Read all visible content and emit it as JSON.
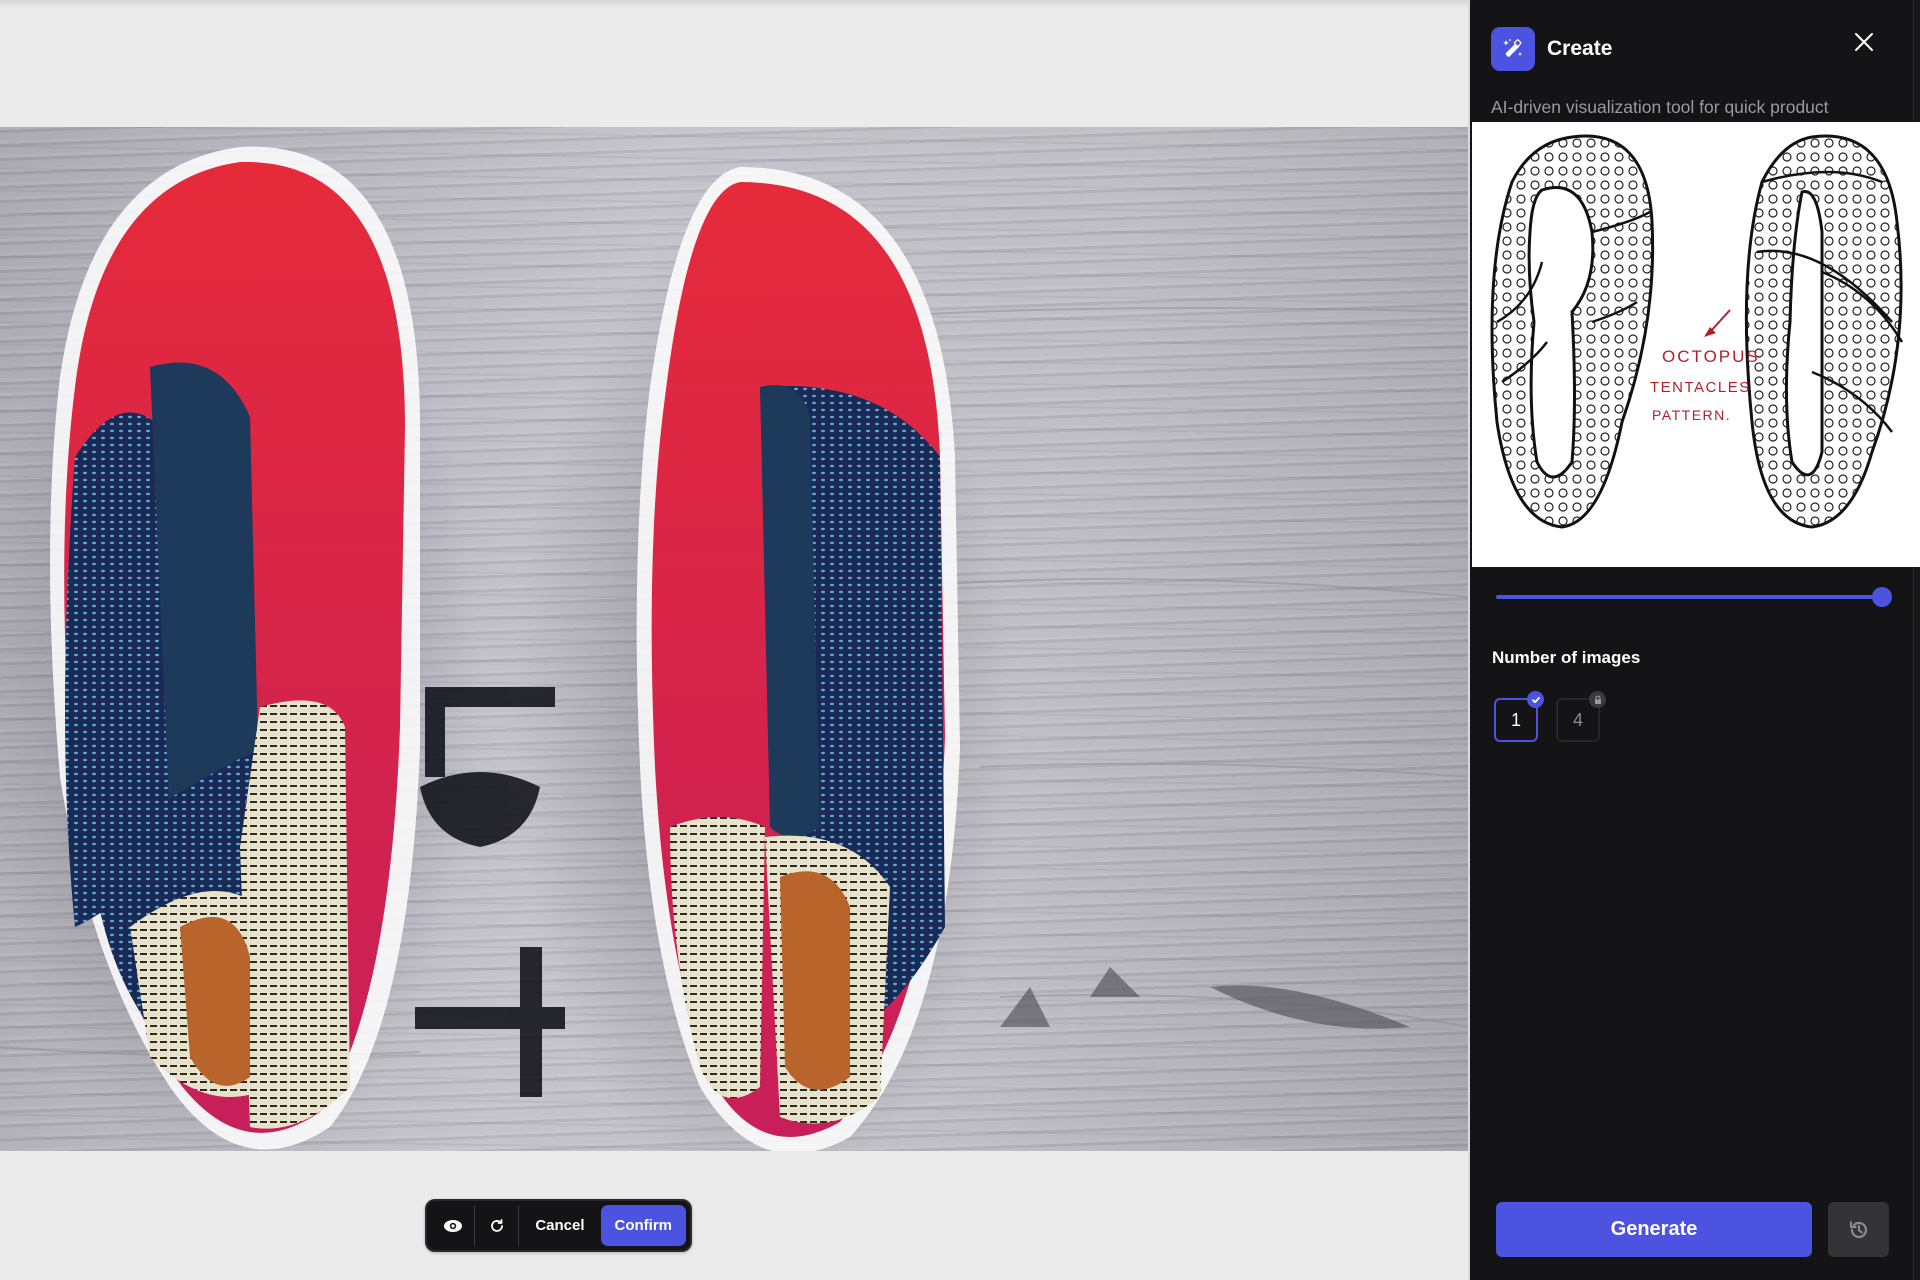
{
  "canvas": {
    "image_alt": "AI-generated render of red, blue and patterned sneakers on a grey wooden floor"
  },
  "toolbar": {
    "preview_icon": "eye-icon",
    "refresh_icon": "refresh-icon",
    "cancel_label": "Cancel",
    "confirm_label": "Confirm"
  },
  "panel": {
    "app_icon": "magic-wand-icon",
    "title": "Create",
    "close_icon": "close-icon",
    "description": "AI-driven visualization tool for quick product visualization and design exploration.",
    "sketch": {
      "alt": "Hand-drawn sketch of two shoe soles with octopus tentacles pattern",
      "annotation_lines": [
        "OCTOPUS",
        "TENTACLES",
        "PATTERN."
      ]
    },
    "slider": {
      "value_fraction": 1.0
    },
    "number_of_images": {
      "label": "Number of images",
      "options": [
        {
          "value": "1",
          "selected": true,
          "locked": false,
          "badge_icon": "check-icon"
        },
        {
          "value": "4",
          "selected": false,
          "locked": true,
          "badge_icon": "lock-icon"
        }
      ]
    },
    "generate_label": "Generate",
    "history_icon": "history-icon"
  },
  "colors": {
    "accent": "#4b53e0",
    "panel_bg": "#141416",
    "canvas_bg": "#ebebeb"
  }
}
